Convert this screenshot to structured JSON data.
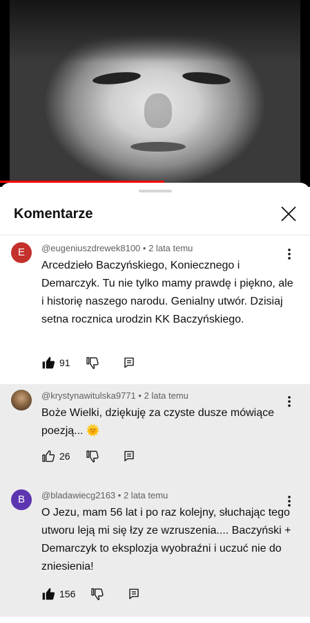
{
  "sheet": {
    "title": "Komentarze"
  },
  "comments": [
    {
      "avatar_letter": "E",
      "avatar_color": "#c4302b",
      "author": "@eugeniuszdrewek8100",
      "time": "2 lata temu",
      "text": "Arcedzieło  Baczyńskiego, Koniecznego i Demarczyk. Tu nie tylko mamy prawdę i piękno, ale  i historię naszego narodu. Genialny utwór. Dzisiaj setna rocznica urodzin KK Baczyńskiego.",
      "likes": "91",
      "liked": true
    },
    {
      "avatar_letter": "",
      "author": "@krystynawitulska9771",
      "time": "2 lata temu",
      "text": "Boże Wielki, dziękuję za czyste dusze mówiące poezją... 🌞",
      "likes": "26",
      "liked": false
    },
    {
      "avatar_letter": "B",
      "avatar_color": "#5e35b1",
      "author": "@bladawiecg2163",
      "time": "2 lata temu",
      "text": "O Jezu, mam 56 lat i po raz kolejny, słuchając tego utworu leją mi się łzy ze wzruszenia.... Baczyński + Demarczyk to eksplozja wyobraźni i uczuć nie do zniesienia!",
      "likes": "156",
      "liked": true
    }
  ],
  "icons": {
    "close": "close-icon",
    "more": "more-vert-icon",
    "like": "thumb-up-icon",
    "dislike": "thumb-down-icon",
    "reply": "reply-icon"
  },
  "colors": {
    "progress": "#ff0000",
    "highlight_bg": "#ececec"
  },
  "video": {
    "progress_fraction": 0.53
  }
}
